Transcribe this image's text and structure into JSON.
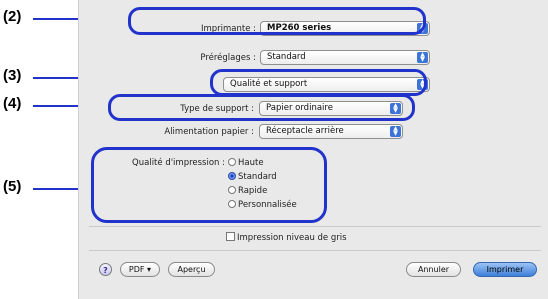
{
  "callouts": [
    "(2)",
    "(3)",
    "(4)",
    "(5)"
  ],
  "printer": {
    "label": "Imprimante :",
    "value": "MP260 series"
  },
  "presets": {
    "label": "Préréglages :",
    "value": "Standard"
  },
  "panel": {
    "value": "Qualité et support"
  },
  "media_type": {
    "label": "Type de support :",
    "value": "Papier ordinaire"
  },
  "paper_source": {
    "label": "Alimentation papier :",
    "value": "Réceptacle arrière"
  },
  "print_quality": {
    "label": "Qualité d'impression :",
    "options": [
      "Haute",
      "Standard",
      "Rapide",
      "Personnalisée"
    ],
    "selected": "Standard"
  },
  "grayscale": {
    "label": "Impression niveau de gris",
    "checked": false
  },
  "footer": {
    "help": "?",
    "pdf": "PDF ▾",
    "preview": "Aperçu",
    "cancel": "Annuler",
    "print": "Imprimer"
  },
  "colors": {
    "accent_ring": "#2233cc",
    "default_button": "#3e7fd9"
  }
}
